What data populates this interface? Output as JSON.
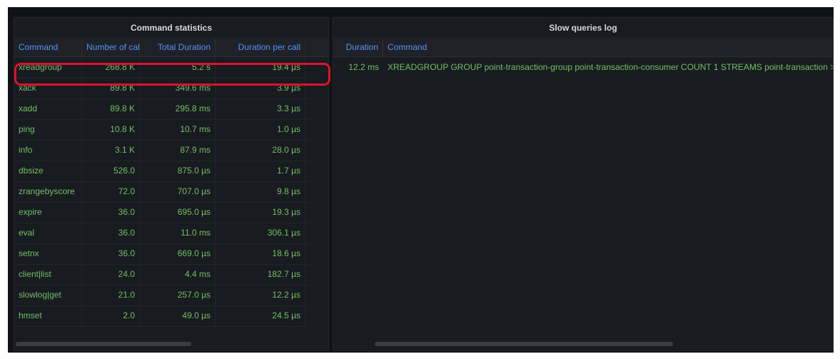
{
  "command_statistics": {
    "title": "Command statistics",
    "columns": [
      "Command",
      "Number of calls",
      "Total Duration",
      "Duration per call"
    ],
    "rows": [
      {
        "command": "xreadgroup",
        "calls": "268.8 K",
        "total": "5.2 s",
        "per_call": "19.4 µs"
      },
      {
        "command": "xack",
        "calls": "89.8 K",
        "total": "349.6 ms",
        "per_call": "3.9 µs"
      },
      {
        "command": "xadd",
        "calls": "89.8 K",
        "total": "295.8 ms",
        "per_call": "3.3 µs"
      },
      {
        "command": "ping",
        "calls": "10.8 K",
        "total": "10.7 ms",
        "per_call": "1.0 µs"
      },
      {
        "command": "info",
        "calls": "3.1 K",
        "total": "87.9 ms",
        "per_call": "28.0 µs"
      },
      {
        "command": "dbsize",
        "calls": "526.0",
        "total": "875.0 µs",
        "per_call": "1.7 µs"
      },
      {
        "command": "zrangebyscore",
        "calls": "72.0",
        "total": "707.0 µs",
        "per_call": "9.8 µs"
      },
      {
        "command": "expire",
        "calls": "36.0",
        "total": "695.0 µs",
        "per_call": "19.3 µs"
      },
      {
        "command": "eval",
        "calls": "36.0",
        "total": "11.0 ms",
        "per_call": "306.1 µs"
      },
      {
        "command": "setnx",
        "calls": "36.0",
        "total": "669.0 µs",
        "per_call": "18.6 µs"
      },
      {
        "command": "client|list",
        "calls": "24.0",
        "total": "4.4 ms",
        "per_call": "182.7 µs"
      },
      {
        "command": "slowlog|get",
        "calls": "21.0",
        "total": "257.0 µs",
        "per_call": "12.2 µs"
      },
      {
        "command": "hmset",
        "calls": "2.0",
        "total": "49.0 µs",
        "per_call": "24.5 µs"
      }
    ]
  },
  "slow_queries_log": {
    "title": "Slow queries log",
    "columns": [
      "Duration",
      "Command"
    ],
    "rows": [
      {
        "duration": "12.2 ms",
        "command": "XREADGROUP GROUP point-transaction-group point-transaction-consumer COUNT 1 STREAMS point-transaction >"
      }
    ]
  },
  "colors": {
    "background": "#111217",
    "panel": "#181b1f",
    "header_text": "#5794f2",
    "cell_text": "#73bf69",
    "highlight": "#e0102f"
  }
}
